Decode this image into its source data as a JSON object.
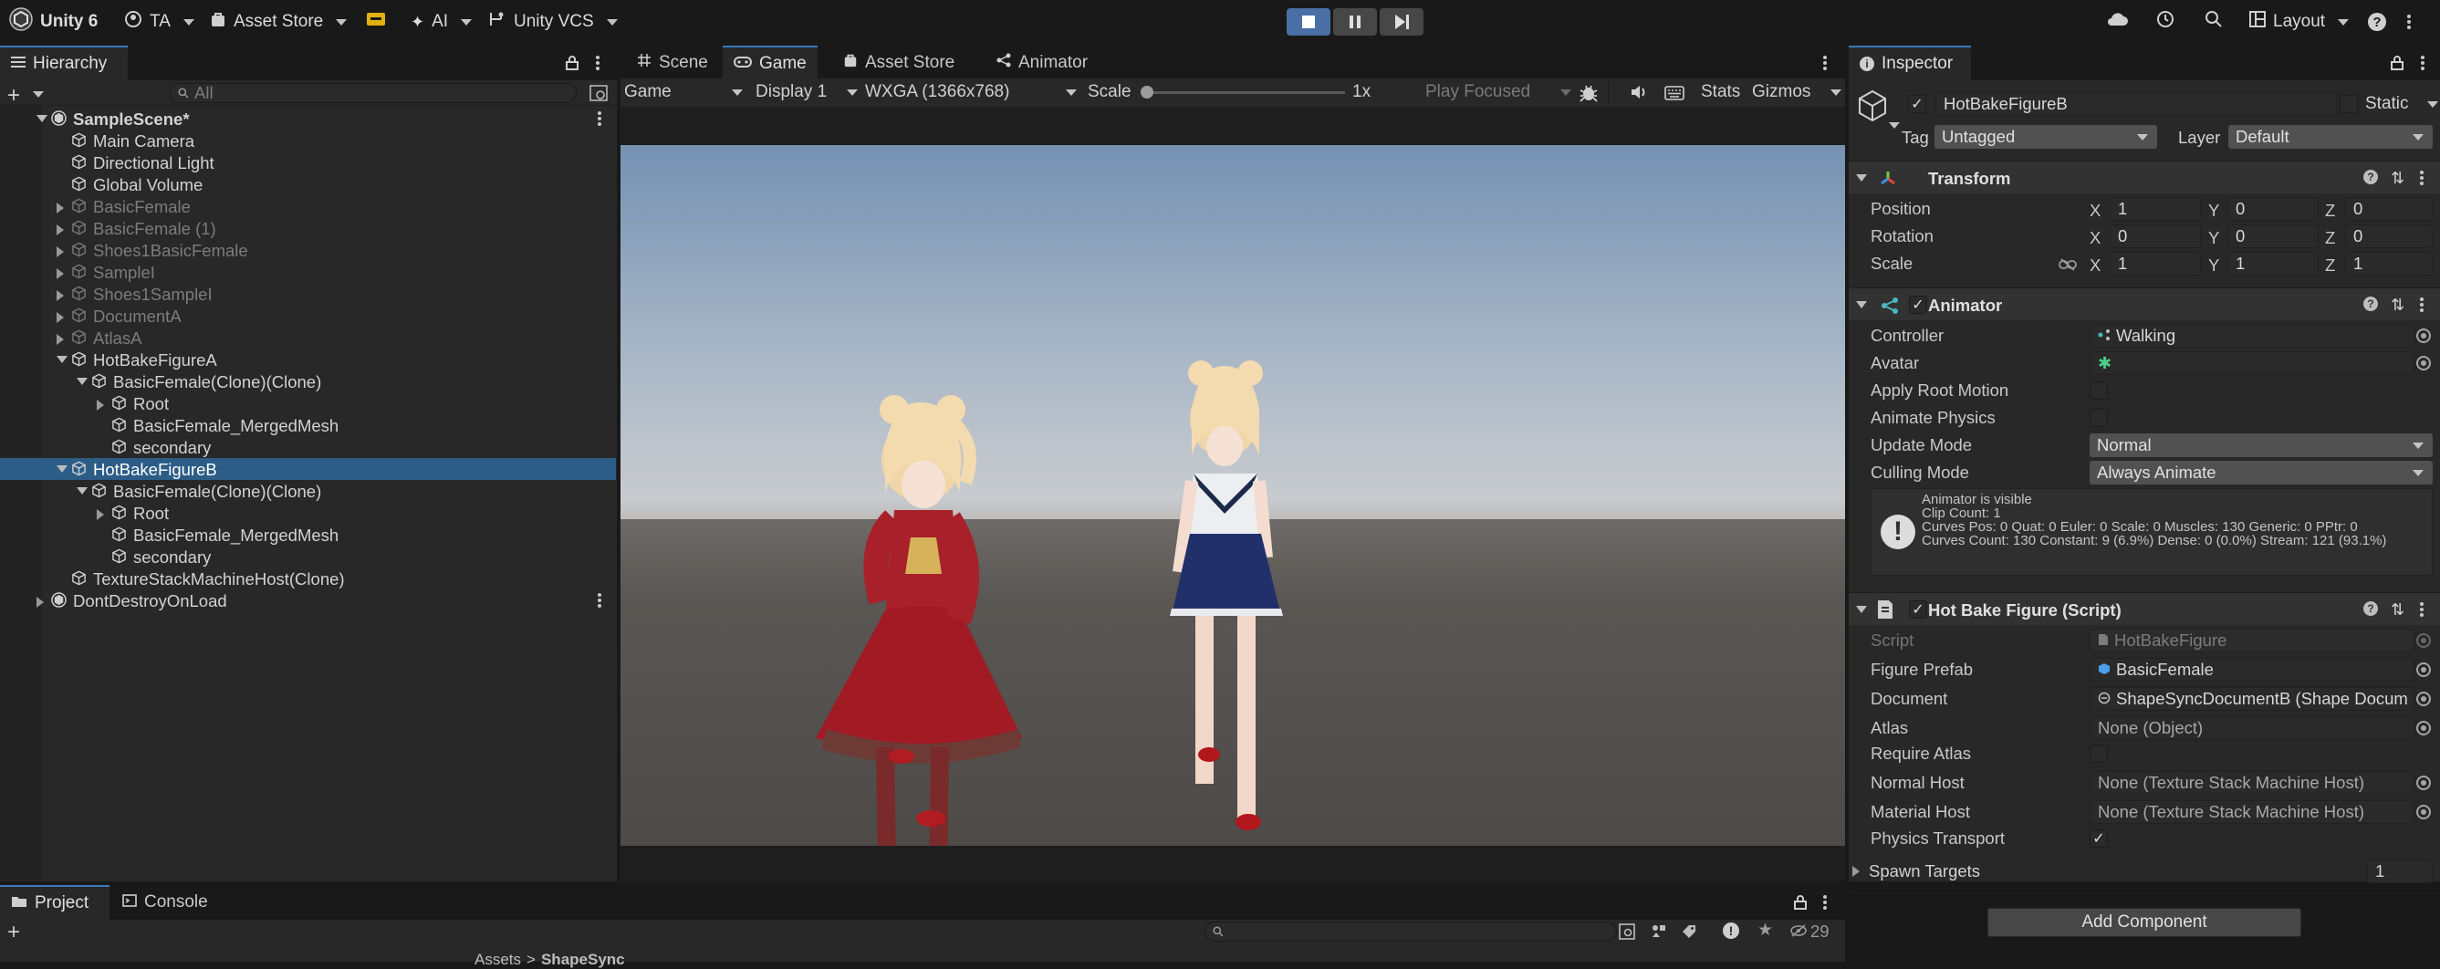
{
  "topbar": {
    "app_name": "Unity 6",
    "account": "TA",
    "asset_store": "Asset Store",
    "ai": "AI",
    "vcs": "Unity VCS",
    "layout": "Layout"
  },
  "hierarchy": {
    "tab": "Hierarchy",
    "search_placeholder": "All",
    "items": [
      {
        "label": "SampleScene*",
        "indent": 0,
        "expand": "down",
        "type": "scene",
        "dim": false,
        "selected": false,
        "bold": true
      },
      {
        "label": "Main Camera",
        "indent": 1,
        "expand": "none",
        "type": "go",
        "dim": false,
        "selected": false
      },
      {
        "label": "Directional Light",
        "indent": 1,
        "expand": "none",
        "type": "go",
        "dim": false,
        "selected": false
      },
      {
        "label": "Global Volume",
        "indent": 1,
        "expand": "none",
        "type": "go",
        "dim": false,
        "selected": false
      },
      {
        "label": "BasicFemale",
        "indent": 1,
        "expand": "right",
        "type": "go",
        "dim": true,
        "selected": false
      },
      {
        "label": "BasicFemale (1)",
        "indent": 1,
        "expand": "right",
        "type": "go",
        "dim": true,
        "selected": false
      },
      {
        "label": "Shoes1BasicFemale",
        "indent": 1,
        "expand": "right",
        "type": "go",
        "dim": true,
        "selected": false
      },
      {
        "label": "SampleI",
        "indent": 1,
        "expand": "right",
        "type": "go",
        "dim": true,
        "selected": false
      },
      {
        "label": "Shoes1SampleI",
        "indent": 1,
        "expand": "right",
        "type": "go",
        "dim": true,
        "selected": false
      },
      {
        "label": "DocumentA",
        "indent": 1,
        "expand": "right",
        "type": "go",
        "dim": true,
        "selected": false
      },
      {
        "label": "AtlasA",
        "indent": 1,
        "expand": "right",
        "type": "go",
        "dim": true,
        "selected": false
      },
      {
        "label": "HotBakeFigureA",
        "indent": 1,
        "expand": "down",
        "type": "go",
        "dim": false,
        "selected": false
      },
      {
        "label": "BasicFemale(Clone)(Clone)",
        "indent": 2,
        "expand": "down",
        "type": "go",
        "dim": false,
        "selected": false
      },
      {
        "label": "Root",
        "indent": 3,
        "expand": "right",
        "type": "go",
        "dim": false,
        "selected": false
      },
      {
        "label": "BasicFemale_MergedMesh",
        "indent": 3,
        "expand": "none",
        "type": "go",
        "dim": false,
        "selected": false
      },
      {
        "label": "secondary",
        "indent": 3,
        "expand": "none",
        "type": "go",
        "dim": false,
        "selected": false
      },
      {
        "label": "HotBakeFigureB",
        "indent": 1,
        "expand": "down",
        "type": "go",
        "dim": false,
        "selected": true
      },
      {
        "label": "BasicFemale(Clone)(Clone)",
        "indent": 2,
        "expand": "down",
        "type": "go",
        "dim": false,
        "selected": false
      },
      {
        "label": "Root",
        "indent": 3,
        "expand": "right",
        "type": "go",
        "dim": false,
        "selected": false
      },
      {
        "label": "BasicFemale_MergedMesh",
        "indent": 3,
        "expand": "none",
        "type": "go",
        "dim": false,
        "selected": false
      },
      {
        "label": "secondary",
        "indent": 3,
        "expand": "none",
        "type": "go",
        "dim": false,
        "selected": false
      },
      {
        "label": "TextureStackMachineHost(Clone)",
        "indent": 1,
        "expand": "none",
        "type": "go",
        "dim": false,
        "selected": false
      },
      {
        "label": "DontDestroyOnLoad",
        "indent": 0,
        "expand": "right",
        "type": "scene",
        "dim": false,
        "selected": false
      }
    ]
  },
  "center": {
    "tabs": [
      "Scene",
      "Game",
      "Asset Store",
      "Animator"
    ],
    "game_toolbar": {
      "view": "Game",
      "display": "Display 1",
      "resolution": "WXGA (1366x768)",
      "scale_label": "Scale",
      "scale_value": "1x",
      "play_focused": "Play Focused",
      "stats": "Stats",
      "gizmos": "Gizmos"
    }
  },
  "inspector": {
    "tab": "Inspector",
    "object_name": "HotBakeFigureB",
    "static_label": "Static",
    "tag_label": "Tag",
    "tag_value": "Untagged",
    "layer_label": "Layer",
    "layer_value": "Default",
    "transform": {
      "title": "Transform",
      "position_label": "Position",
      "position": [
        "1",
        "0",
        "0"
      ],
      "rotation_label": "Rotation",
      "rotation": [
        "0",
        "0",
        "0"
      ],
      "scale_label": "Scale",
      "scale": [
        "1",
        "1",
        "1"
      ],
      "axes": [
        "X",
        "Y",
        "Z"
      ]
    },
    "animator": {
      "title": "Animator",
      "controller_label": "Controller",
      "controller_value": "Walking",
      "avatar_label": "Avatar",
      "apply_root_motion_label": "Apply Root Motion",
      "animate_physics_label": "Animate Physics",
      "update_mode_label": "Update Mode",
      "update_mode_value": "Normal",
      "culling_mode_label": "Culling Mode",
      "culling_mode_value": "Always Animate",
      "info_lines": [
        "Animator is visible",
        "Clip Count: 1",
        "Curves Pos: 0 Quat: 0 Euler: 0 Scale: 0 Muscles: 130 Generic: 0 PPtr: 0",
        "Curves Count: 130 Constant: 9 (6.9%) Dense: 0 (0.0%) Stream: 121 (93.1%)"
      ]
    },
    "script": {
      "title": "Hot Bake Figure (Script)",
      "script_label": "Script",
      "script_value": "HotBakeFigure",
      "figure_prefab_label": "Figure Prefab",
      "figure_prefab_value": "BasicFemale",
      "document_label": "Document",
      "document_value": "ShapeSyncDocumentB (Shape Docum",
      "atlas_label": "Atlas",
      "atlas_value": "None (Object)",
      "require_atlas_label": "Require Atlas",
      "normal_host_label": "Normal Host",
      "normal_host_value": "None (Texture Stack Machine Host)",
      "material_host_label": "Material Host",
      "material_host_value": "None (Texture Stack Machine Host)",
      "physics_transport_label": "Physics Transport",
      "spawn_targets_label": "Spawn Targets",
      "spawn_targets_value": "1"
    },
    "add_component": "Add Component"
  },
  "bottom": {
    "tabs": [
      "Project",
      "Console"
    ],
    "visibility_count": "29",
    "breadcrumb": [
      "Assets",
      "ShapeSync"
    ]
  }
}
